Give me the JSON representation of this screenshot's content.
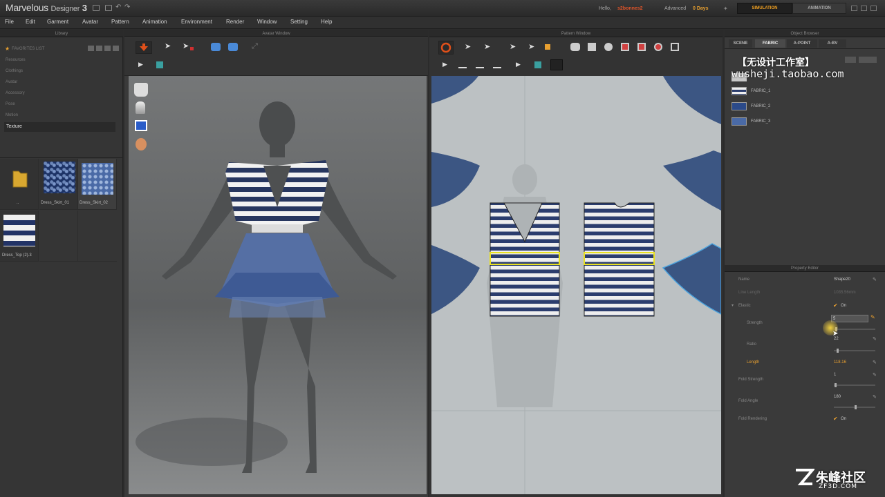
{
  "titlebar": {
    "app_name": "Marvelous",
    "app_sub": "Designer",
    "app_ver": "3",
    "hello": "Hello,",
    "user": "s2bonnes2",
    "plan": "Advanced",
    "days": "0 Days",
    "mode_tabs": [
      "SIMULATION",
      "ANIMATION"
    ]
  },
  "menu": [
    "File",
    "Edit",
    "Garment",
    "Avatar",
    "Pattern",
    "Animation",
    "Environment",
    "Render",
    "Window",
    "Setting",
    "Help"
  ],
  "library": {
    "header": "Library",
    "favorites": "FAVORITES LIST",
    "items": [
      "Resources",
      "Clothings",
      "Avatar",
      "Accessory",
      "Pose",
      "Motion"
    ],
    "selected": "Texture",
    "thumbs": [
      {
        "label": "..",
        "kind": "folder"
      },
      {
        "label": "Dress_Skirt_01",
        "kind": "pattern-dark"
      },
      {
        "label": "Dress_Skirt_02",
        "kind": "pattern-light"
      },
      {
        "label": "Dress_Top (2).3",
        "kind": "stripes"
      }
    ]
  },
  "avatar_window": {
    "header": "Avatar Window"
  },
  "pattern_window": {
    "header": "Pattern Window"
  },
  "object_browser": {
    "header": "Object Browser",
    "tabs": [
      "SCENE",
      "FABRIC",
      "A-POINT",
      "A-BV"
    ],
    "fabrics": [
      "FABRIC_1",
      "FABRIC_2",
      "FABRIC_3"
    ]
  },
  "property_editor": {
    "header": "Property Editor",
    "rows": [
      {
        "label": "Name",
        "value": "Shape20"
      },
      {
        "label": "Line Length",
        "value": "1035.56mm"
      },
      {
        "label": "Elastic",
        "value": "On"
      },
      {
        "label": "Strength",
        "value": "5"
      },
      {
        "label": "Ratio",
        "value": "22"
      },
      {
        "label": "Length",
        "value": "118.16"
      },
      {
        "label": "Fold Strength",
        "value": "1"
      },
      {
        "label": "Fold Angle",
        "value": "180"
      },
      {
        "label": "Fold Rendering",
        "value": "On"
      }
    ]
  },
  "watermarks": {
    "cn_title": "【无设计工作室】",
    "shop": "wusheji.taobao.com",
    "site_cn": "朱峰社区",
    "site_url": "ZF3D.COM"
  },
  "colors": {
    "accent": "#e8a030",
    "fabric_blue": "#2b3d6e",
    "seam_yellow": "#e8e020"
  }
}
